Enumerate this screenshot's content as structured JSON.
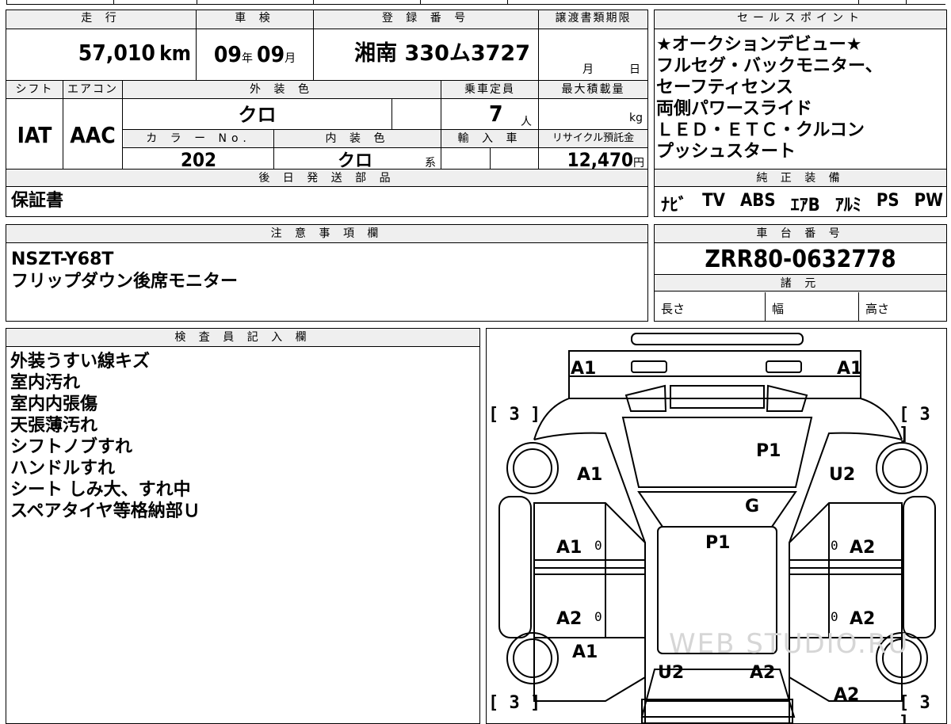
{
  "top_strip": {
    "left_text": "",
    "mid_text": ""
  },
  "vehicle": {
    "headers": {
      "mileage": "走 行",
      "inspection": "車 検",
      "registration": "登 録 番 号",
      "transfer_deadline": "譲渡書類期限"
    },
    "mileage": "57,010",
    "mileage_unit": "km",
    "inspection_year": "09",
    "inspection_year_unit": "年",
    "inspection_month": "09",
    "inspection_month_unit": "月",
    "registration": "湘南 330ム3727",
    "transfer_month_unit": "月",
    "transfer_day_unit": "日"
  },
  "row2": {
    "headers": {
      "shift": "シフト",
      "aircon": "エアコン",
      "exterior_color": "外 装 色",
      "capacity": "乗車定員",
      "max_load": "最大積載量"
    },
    "shift": "IAT",
    "aircon": "AAC",
    "exterior_color": "クロ",
    "capacity": "7",
    "capacity_unit": "人",
    "max_load_unit": "kg"
  },
  "row3": {
    "headers": {
      "color_no": "カ ラ ー No.",
      "interior_color": "内 装 色",
      "imported": "輸 入 車",
      "recycle": "リサイクル預託金"
    },
    "color_no": "202",
    "interior_color": "クロ",
    "interior_suffix": "系",
    "recycle_fee": "12,470",
    "recycle_unit": "円"
  },
  "later_shipping": {
    "header": "後 日 発 送 部 品",
    "value": "保証書"
  },
  "sales_points": {
    "header": "セールスポイント",
    "lines": [
      "★オークションデビュー★",
      "フルセグ・バックモニター、",
      "セーフティセンス",
      "両側パワースライド",
      "ＬＥＤ・ＥＴＣ・クルコン",
      "プッシュスタート"
    ]
  },
  "genuine_equipment": {
    "header": "純 正 装 備",
    "items": [
      "ﾅﾋﾞ",
      "TV",
      "ABS",
      "ｴｱB",
      "ｱﾙﾐ",
      "PS",
      "PW"
    ]
  },
  "notes": {
    "header": "注 意 事 項 欄",
    "lines": [
      "NSZT-Y68T",
      "フリップダウン後席モニター"
    ]
  },
  "chassis": {
    "header": "車 台 番 号",
    "value": "ZRR80-0632778"
  },
  "specs": {
    "header": "諸 元",
    "length": "長さ",
    "width": "幅",
    "height": "高さ"
  },
  "inspector": {
    "header": "検 査 員 記 入 欄",
    "lines": [
      "外装うすい線キズ",
      "室内汚れ",
      "室内内張傷",
      "天張薄汚れ",
      "シフトノブすれ",
      "ハンドルすれ",
      "シート しみ大、すれ中",
      "スペアタイヤ等格納部Ｕ"
    ]
  },
  "damage_map": {
    "marks": {
      "front_left": "A1",
      "front_right": "A1",
      "fender_left": "A1",
      "fender_right": "U2",
      "hood": "P1",
      "windshield": "G",
      "roof": "P1",
      "front_door_left": "A1",
      "front_door_right": "A2",
      "rear_door_left": "A2",
      "rear_door_right": "A2",
      "quarter_left": "A1",
      "quarter_right": "A2",
      "rear_left": "U2",
      "rear_right": "A2"
    },
    "zero": "0",
    "tire_label": "[ 3 ]",
    "watermark": "WEB STUDIO.RU"
  }
}
